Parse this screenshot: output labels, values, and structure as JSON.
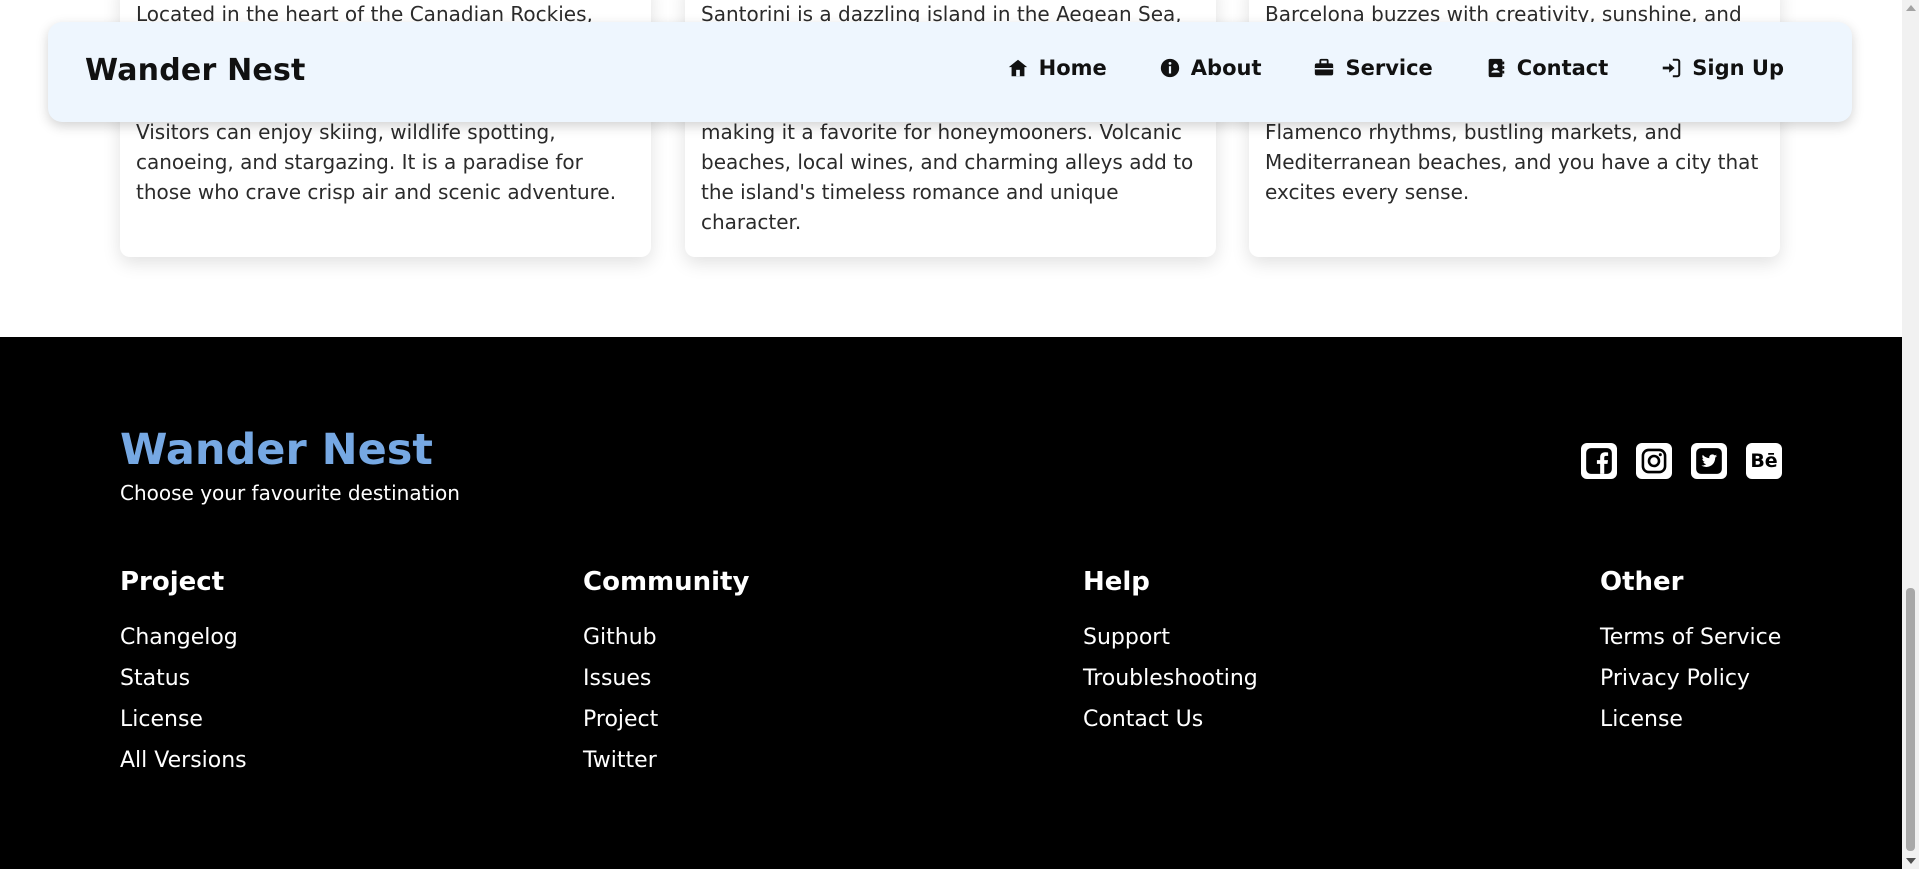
{
  "cards": [
    {
      "first_line": "Located in the heart of the Canadian Rockies,",
      "rest": "Visitors can enjoy skiing, wildlife spotting, canoeing, and stargazing. It is a paradise for those who crave crisp air and scenic adventure."
    },
    {
      "first_line": "Santorini is a dazzling island in the Aegean Sea,",
      "rest": "making it a favorite for honeymooners. Volcanic beaches, local wines, and charming alleys add to the island's timeless romance and unique character."
    },
    {
      "first_line": "Barcelona buzzes with creativity, sunshine, and",
      "rest": "Flamenco rhythms, bustling markets, and Mediterranean beaches, and you have a city that excites every sense."
    }
  ],
  "navbar": {
    "brand": "Wander Nest",
    "links": [
      {
        "label": "Home",
        "icon": "home-icon"
      },
      {
        "label": "About",
        "icon": "info-icon"
      },
      {
        "label": "Service",
        "icon": "briefcase-icon"
      },
      {
        "label": "Contact",
        "icon": "address-book-icon"
      },
      {
        "label": "Sign Up",
        "icon": "sign-in-icon"
      }
    ]
  },
  "footer": {
    "brand": "Wander Nest",
    "tagline": "Choose your favourite destination",
    "socials": [
      "facebook-icon",
      "instagram-icon",
      "twitter-icon",
      "behance-icon"
    ],
    "behance_text": "Bē",
    "columns": [
      {
        "title": "Project",
        "links": [
          "Changelog",
          "Status",
          "License",
          "All Versions"
        ]
      },
      {
        "title": "Community",
        "links": [
          "Github",
          "Issues",
          "Project",
          "Twitter"
        ]
      },
      {
        "title": "Help",
        "links": [
          "Support",
          "Troubleshooting",
          "Contact Us"
        ]
      },
      {
        "title": "Other",
        "links": [
          "Terms of Service",
          "Privacy Policy",
          "License"
        ]
      }
    ]
  },
  "colors": {
    "navbar_bg": "#eef6fe",
    "footer_bg": "#000000",
    "footer_brand": "#76a8e3"
  }
}
